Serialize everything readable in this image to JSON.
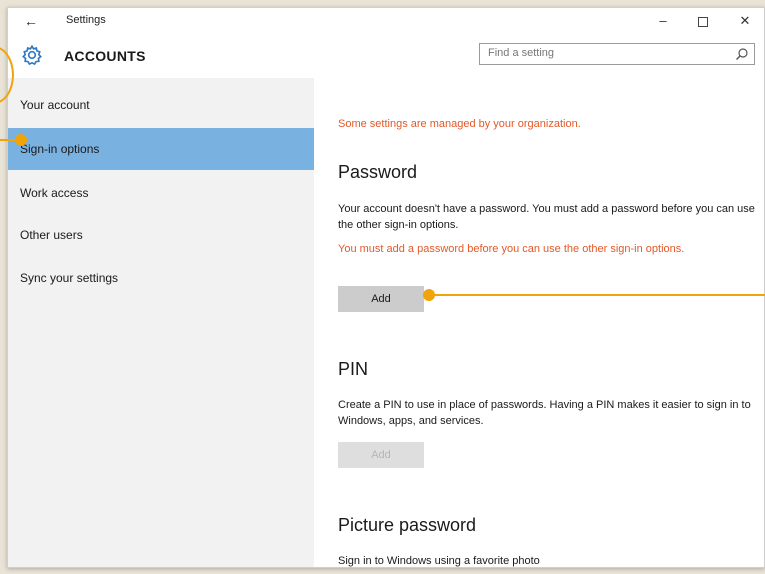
{
  "window": {
    "title": "Settings",
    "back_glyph": "←",
    "minimize_glyph": "–",
    "close_glyph": "✕"
  },
  "header": {
    "title": "ACCOUNTS",
    "icon": "gear-icon",
    "search": {
      "placeholder": "Find a setting",
      "icon": "search-icon"
    }
  },
  "sidebar": {
    "items": [
      {
        "label": "Your account",
        "selected": false
      },
      {
        "label": "Sign-in options",
        "selected": true
      },
      {
        "label": "Work access",
        "selected": false
      },
      {
        "label": "Other users",
        "selected": false
      },
      {
        "label": "Sync your settings",
        "selected": false
      }
    ]
  },
  "content": {
    "org_note": "Some settings are managed by your organization.",
    "password": {
      "heading": "Password",
      "description": "Your account doesn't have a password. You must add a password before you can use the other sign-in options.",
      "warning": "You must add a password before you can use the other sign-in options.",
      "button_label": "Add"
    },
    "pin": {
      "heading": "PIN",
      "description": "Create a PIN to use in place of passwords. Having a PIN makes it easier to sign in to Windows, apps, and services.",
      "button_label": "Add",
      "button_enabled": false
    },
    "picture_password": {
      "heading": "Picture password",
      "description": "Sign in to Windows using a favorite photo"
    }
  },
  "colors": {
    "accent_selected": "#79b1e0",
    "warning_text": "#e05a2a",
    "callout": "#f0a30a",
    "sidebar_bg": "#f2f2f2"
  }
}
